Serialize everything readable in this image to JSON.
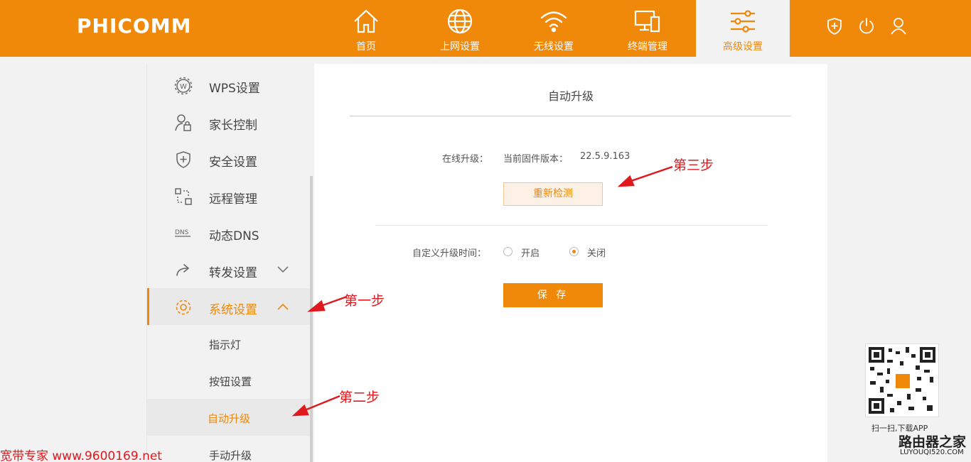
{
  "header": {
    "logo": "PHICOMM",
    "nav": [
      {
        "label": "首页",
        "icon": "home-icon"
      },
      {
        "label": "上网设置",
        "icon": "globe-icon"
      },
      {
        "label": "无线设置",
        "icon": "wifi-icon"
      },
      {
        "label": "终端管理",
        "icon": "devices-icon"
      },
      {
        "label": "高级设置",
        "icon": "sliders-icon"
      }
    ],
    "active_nav": "高级设置",
    "right_icons": [
      "shield-plus-icon",
      "power-icon",
      "user-icon"
    ]
  },
  "sidebar": {
    "items": [
      {
        "label": "WPS设置",
        "icon": "wps-gear-icon"
      },
      {
        "label": "家长控制",
        "icon": "parent-lock-icon"
      },
      {
        "label": "安全设置",
        "icon": "shield-icon"
      },
      {
        "label": "远程管理",
        "icon": "remote-icon"
      },
      {
        "label": "动态DNS",
        "icon": "dns-icon"
      },
      {
        "label": "转发设置",
        "icon": "forward-icon"
      },
      {
        "label": "系统设置",
        "icon": "system-gear-icon"
      }
    ],
    "sub_items": [
      {
        "label": "指示灯"
      },
      {
        "label": "按钮设置"
      },
      {
        "label": "自动升级"
      },
      {
        "label": "手动升级"
      }
    ],
    "active_item": "系统设置",
    "active_sub": "自动升级"
  },
  "main": {
    "title": "自动升级",
    "online_upgrade_label": "在线升级：",
    "firmware_label": "当前固件版本：",
    "firmware_version": "22.5.9.163",
    "recheck_button": "重新检测",
    "custom_time_label": "自定义升级时间：",
    "radio_on": "开启",
    "radio_off": "关闭",
    "selected": "关闭",
    "save_button": "保 存"
  },
  "annotations": {
    "step1": "第一步",
    "step2": "第二步",
    "step3": "第三步"
  },
  "overlay": {
    "qr_caption": "扫一扫,下载APP",
    "watermark_left": "宽带专家 www.9600169.net",
    "watermark_right_1": "路由器之家",
    "watermark_right_2": "LUYOUQI520.COM"
  },
  "colors": {
    "brand": "#f0880a",
    "annotation": "#e0191e"
  }
}
